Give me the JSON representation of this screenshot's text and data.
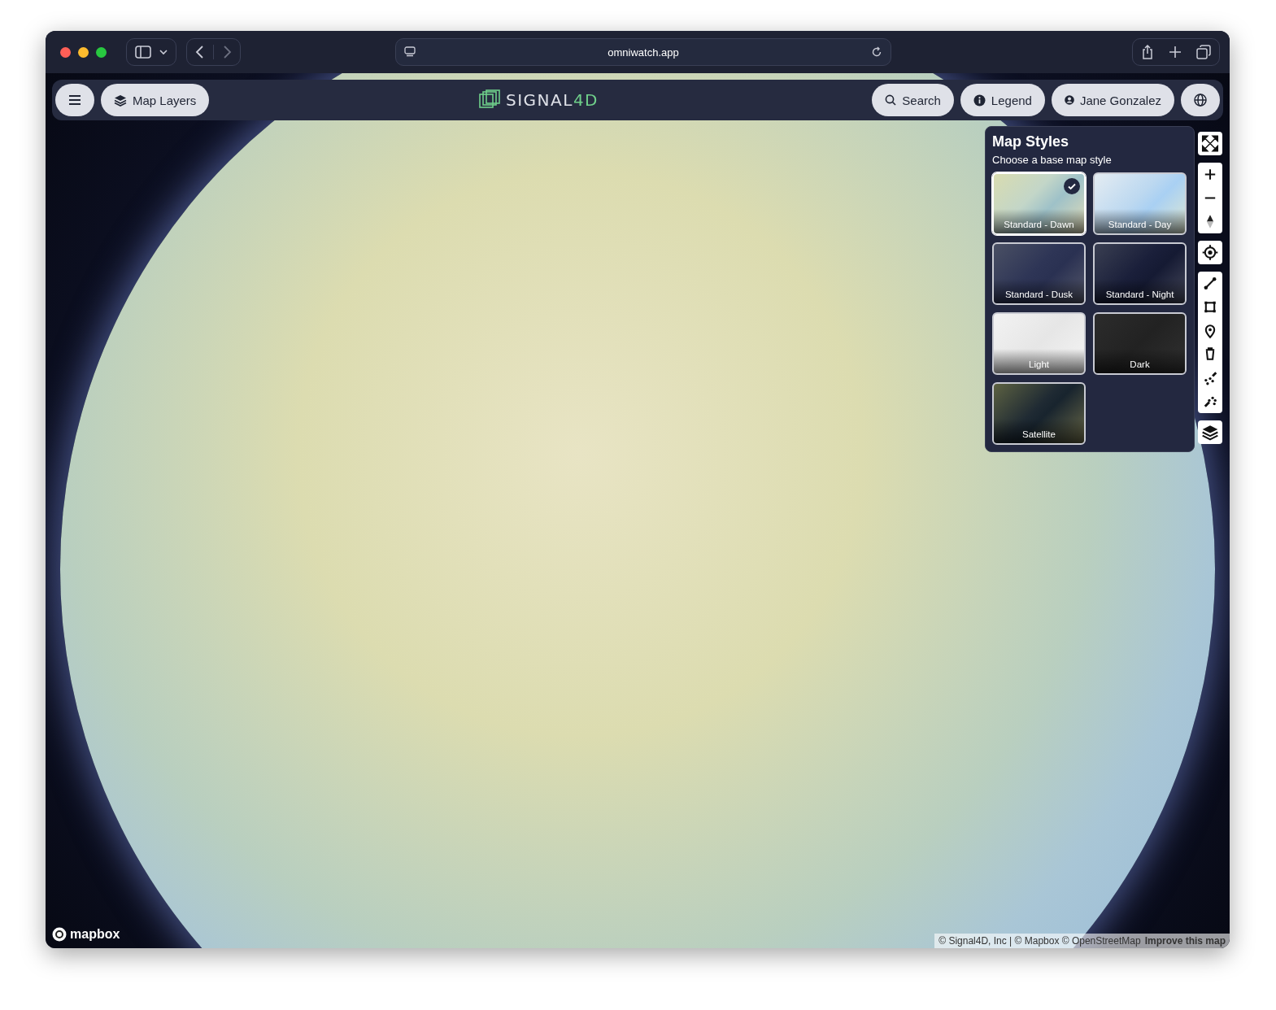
{
  "browser": {
    "url": "omniwatch.app"
  },
  "header": {
    "map_layers": "Map Layers",
    "logo": {
      "text": "SIGNAL",
      "accent": "4D"
    },
    "search": "Search",
    "legend": "Legend",
    "user": "Jane Gonzalez"
  },
  "map_styles": {
    "title": "Map Styles",
    "subtitle": "Choose a base map style",
    "styles": [
      {
        "label": "Standard - Dawn",
        "kind": "dawn",
        "selected": true
      },
      {
        "label": "Standard - Day",
        "kind": "day",
        "selected": false
      },
      {
        "label": "Standard - Dusk",
        "kind": "dusk",
        "selected": false
      },
      {
        "label": "Standard - Night",
        "kind": "night",
        "selected": false
      },
      {
        "label": "Light",
        "kind": "light",
        "selected": false
      },
      {
        "label": "Dark",
        "kind": "dark",
        "selected": false
      },
      {
        "label": "Satellite",
        "kind": "satellite",
        "selected": false
      }
    ]
  },
  "footer": {
    "brand": "mapbox",
    "attribution": "© Signal4D, Inc | © Mapbox © OpenStreetMap",
    "improve": "Improve this map"
  }
}
